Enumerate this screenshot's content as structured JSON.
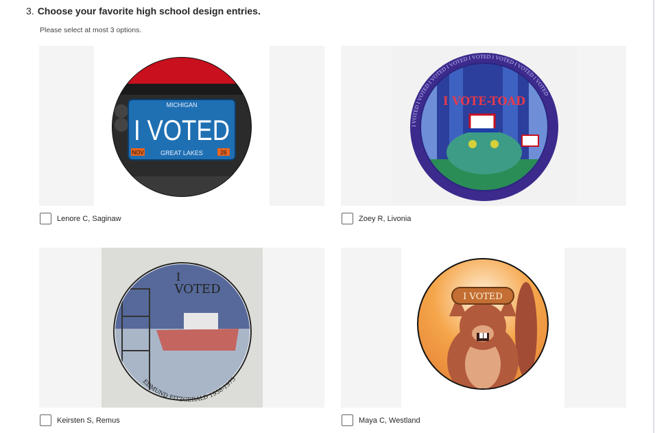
{
  "question": {
    "number": "3.",
    "title": "Choose your favorite high school design entries.",
    "hint": "Please select at most 3 options."
  },
  "options": [
    {
      "label": "Lenore C, Saginaw",
      "checked": false,
      "image": {
        "plate_state": "MICHIGAN",
        "plate_main": "I VOTED",
        "plate_left_tag": "NOV",
        "plate_bottom": "GREAT LAKES",
        "plate_right_tag": "26"
      }
    },
    {
      "label": "Zoey R, Livonia",
      "checked": false,
      "image": {
        "headline": "I VOTE-TOAD",
        "ring_text": "I VOTED I VOTED I VOTED I VOTED I VOTED I VOTED I VOTED I VOTED"
      }
    },
    {
      "label": "Keirsten S, Remus",
      "checked": false,
      "image": {
        "headline_top": "I",
        "headline_bottom": "VOTED",
        "ring_text": "EDMUND FITZGERALD 1958-1975"
      }
    },
    {
      "label": "Maya C, Westland",
      "checked": false,
      "image": {
        "sign_text": "I VOTED"
      }
    }
  ],
  "colors": {
    "plate_blue": "#1f6fb3",
    "plate_red": "#c8101e",
    "toad_purple": "#3c2a8c",
    "beaver_glow": "#f5a54a"
  }
}
